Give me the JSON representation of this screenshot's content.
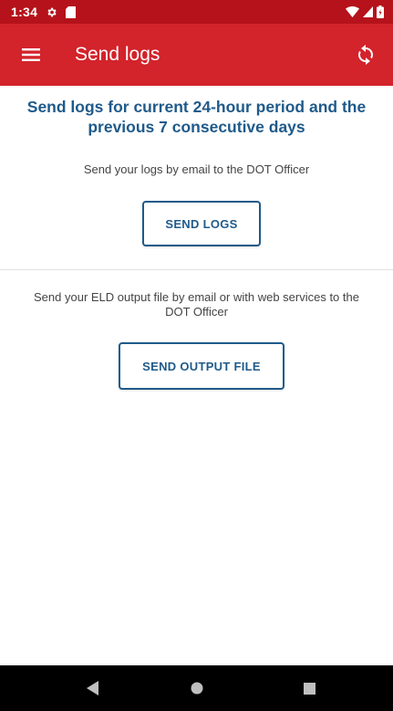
{
  "status_bar": {
    "time": "1:34",
    "icons": [
      "settings-icon",
      "sd-card-icon",
      "wifi-icon",
      "signal-icon",
      "battery-icon"
    ]
  },
  "app_bar": {
    "title": "Send logs",
    "menu_icon": "hamburger-menu-icon",
    "action_icon": "sync-icon"
  },
  "main": {
    "heading": "Send logs for current 24-hour period and the previous 7 consecutive days",
    "send_logs_description": "Send your logs by email to the DOT Officer",
    "send_logs_button": "SEND LOGS",
    "output_file_description": "Send your ELD output file by email or with web services to the DOT Officer",
    "send_output_file_button": "SEND OUTPUT FILE"
  },
  "nav_bar": {
    "buttons": [
      "back-icon",
      "home-icon",
      "recents-icon"
    ]
  },
  "colors": {
    "status_bar": "#b5121b",
    "app_bar": "#d3232b",
    "accent_text": "#1f5a8a",
    "body_text": "#444444",
    "nav_bar": "#000000"
  }
}
